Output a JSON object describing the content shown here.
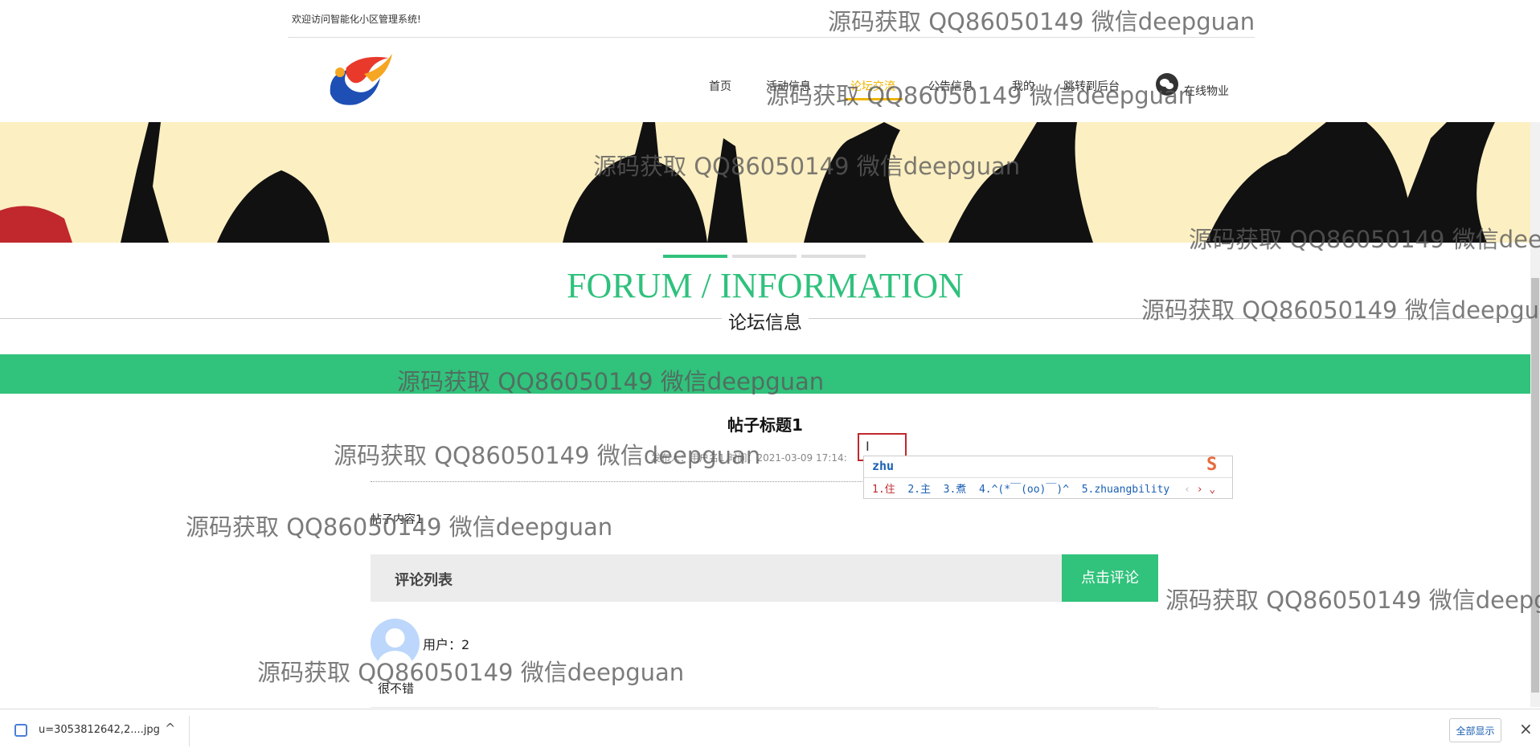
{
  "header": {
    "welcome": "欢迎访问智能化小区管理系统!"
  },
  "nav": {
    "items": [
      {
        "label": "首页"
      },
      {
        "label": "活动信息"
      },
      {
        "label": "论坛交流",
        "active": true
      },
      {
        "label": "公告信息"
      },
      {
        "label": "我的"
      },
      {
        "label": "跳转到后台"
      }
    ],
    "wechat_label": "在线物业"
  },
  "section": {
    "title_en": "FORUM / INFORMATION",
    "title_cn": "论坛信息"
  },
  "post": {
    "title": "帖子标题1",
    "meta": "发布人：用户名1 时间：2021-03-09 17:14:",
    "content": "帖子内容1"
  },
  "comments": {
    "header": "评论列表",
    "button": "点击评论",
    "items": [
      {
        "user": "用户：2",
        "text": "很不错"
      }
    ]
  },
  "ime": {
    "input": "zhu",
    "candidates": [
      "1.住",
      "2.主",
      "3.煮",
      "4.^(*￣(oo)￣)^",
      "5.zhuangbility"
    ]
  },
  "watermark": "源码获取 QQ86050149 微信deepguan",
  "download_bar": {
    "file": "u=3053812642,2....jpg",
    "show_all": "全部显示"
  },
  "colors": {
    "accent": "#31c27c",
    "nav_active": "#f0b400"
  }
}
